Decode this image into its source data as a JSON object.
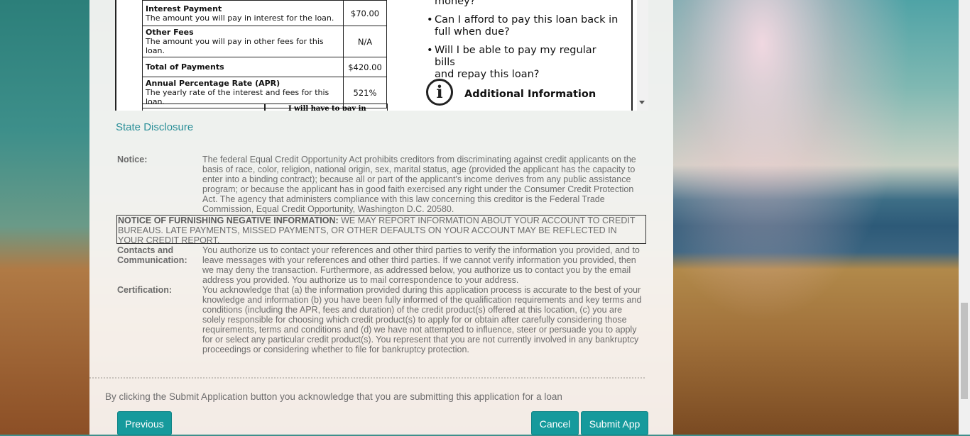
{
  "loan_table": {
    "rows": [
      {
        "title": "Interest Payment",
        "desc": "The amount you will pay in interest for the loan.",
        "value": "$70.00"
      },
      {
        "title": "Other Fees",
        "desc": "The amount you will pay in other fees for this loan.",
        "value": "N/A"
      },
      {
        "title": "Total of Payments",
        "desc": "",
        "value": "$420.00"
      },
      {
        "title": "Annual Percentage Rate (APR)",
        "desc": "The yearly rate of the interest and fees for this loan.",
        "value": "521%"
      }
    ],
    "partial_text": "I will have to pay in"
  },
  "questions": {
    "q0_tail": "money?",
    "q1_line1": "Can I afford to pay this loan back in",
    "q1_line2": "full when due?",
    "q2_line1": "Will I be able to pay my regular bills",
    "q2_line2": "and repay this loan?",
    "bullet": "•"
  },
  "additional_info": {
    "icon_glyph": "i",
    "title": "Additional Information"
  },
  "state_disclosure_title": "State Disclosure",
  "notice": {
    "label": "Notice:",
    "lines": [
      "The federal Equal Credit Opportunity Act prohibits creditors from discriminating against credit applicants on the",
      "basis of race, color, religion, national origin, sex, marital status, age (provided the applicant has the capacity to",
      "enter into a binding contract); because all or part of the applicant's income derives from any public assistance",
      "program; or because the applicant has in good faith exercised any right under the Consumer Credit Protection",
      "Act. The agency that administers compliance with this law concerning this creditor is the Federal Trade",
      "Commission, Equal Credit Opportunity, Washington D.C. 20580."
    ]
  },
  "negative_info": {
    "heading": "NOTICE OF FURNISHING NEGATIVE INFORMATION:",
    "line1_rest": " WE MAY REPORT INFORMATION ABOUT YOUR ACCOUNT TO CREDIT",
    "line2": "BUREAUS. LATE PAYMENTS, MISSED PAYMENTS, OR OTHER DEFAULTS ON YOUR ACCOUNT MAY BE REFLECTED IN",
    "line3": "YOUR CREDIT REPORT."
  },
  "contacts": {
    "label_line1": "Contacts and",
    "label_line2": "Communication:",
    "lines": [
      "You authorize us to contact your references and other third parties to verify the information you provided, and to",
      "leave messages with your references and other third parties. If we cannot verify information you provided, then",
      "we may deny the transaction. Furthermore, as addressed below, you authorize us to contact you by the email",
      "address you provided. You authorize us to mail correspondence to your address."
    ]
  },
  "certification": {
    "label": "Certification:",
    "lines": [
      "You acknowledge that (a) the information provided during this application process is accurate to the best of your",
      "knowledge and information (b) you have been fully informed of the qualification requirements and key terms and",
      "conditions (including the APR, fees and duration) of the credit product(s) offered at this location, (c) you are",
      "solely responsible for choosing which credit product(s) to apply for or obtain after carefully considering those",
      "requirements, terms and conditions and (d) we have not attempted to influence, steer or persuade you to apply",
      "for or select any particular credit product(s). You represent that you are not currently involved in any bankruptcy",
      "proceedings or considering whether to file for bankruptcy protection."
    ]
  },
  "acknowledgement": "By clicking the Submit Application button you acknowledge that you are submitting this application for a loan",
  "buttons": {
    "previous": "Previous",
    "cancel": "Cancel",
    "submit": "Submit App"
  },
  "colors": {
    "accent": "#169a9c",
    "title": "#2a8f98",
    "text": "#6b6b6b"
  }
}
